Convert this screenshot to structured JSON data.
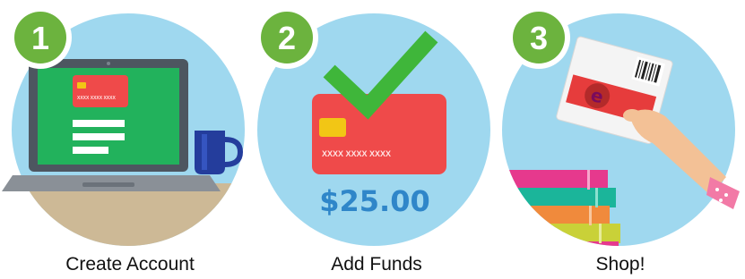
{
  "steps": [
    {
      "number": "1",
      "label": "Create Account",
      "card_number": "XXXX XXXX XXXX",
      "icon": "laptop-icon"
    },
    {
      "number": "2",
      "label": "Add Funds",
      "card_number": "XXXX XXXX XXXX",
      "amount": "$25.00",
      "icon": "credit-card-icon"
    },
    {
      "number": "3",
      "label": "Shop!",
      "icon": "gift-card-hand-icon"
    }
  ],
  "colors": {
    "circle_bg": "#9fd8ef",
    "badge": "#6cb33e",
    "laptop_screen": "#22b25c",
    "card": "#ef4a4a",
    "chip": "#f2c615",
    "check": "#3fb63a",
    "amount": "#2f86c9",
    "mug": "#243d9c"
  }
}
